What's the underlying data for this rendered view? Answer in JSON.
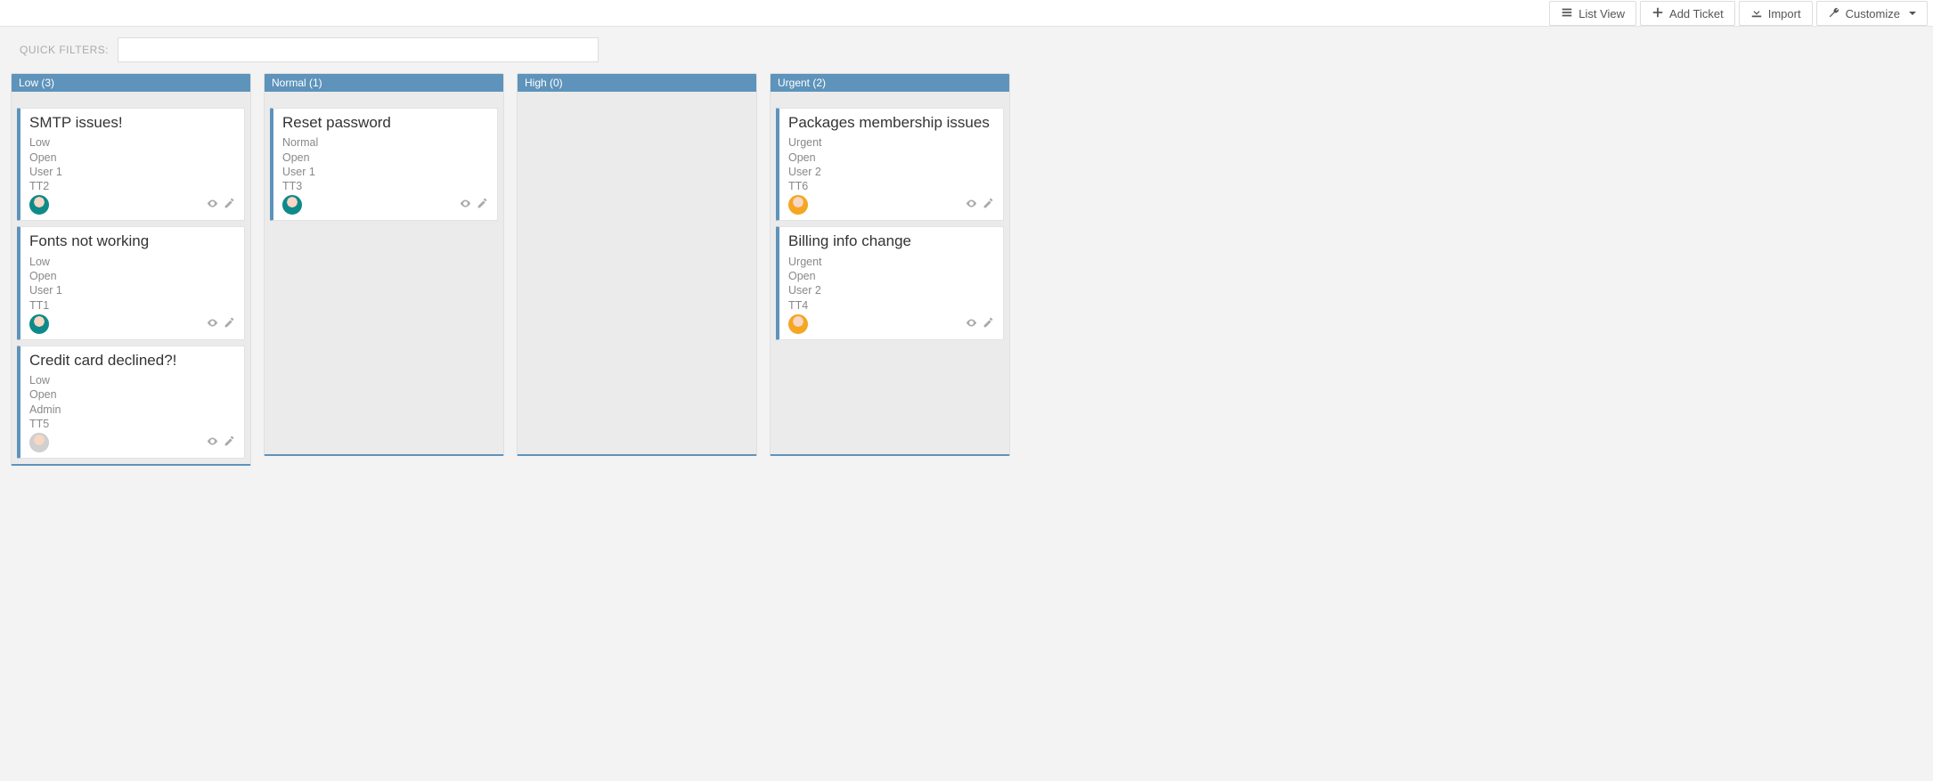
{
  "toolbar": {
    "list_view": "List View",
    "add_ticket": "Add Ticket",
    "import": "Import",
    "customize": "Customize"
  },
  "filters": {
    "label": "QUICK FILTERS:",
    "value": ""
  },
  "columns": [
    {
      "id": "low",
      "header": "Low (3)",
      "cards": [
        {
          "title": "SMTP issues!",
          "priority": "Low",
          "status": "Open",
          "user": "User 1",
          "code": "TT2",
          "avatar": "user1"
        },
        {
          "title": "Fonts not working",
          "priority": "Low",
          "status": "Open",
          "user": "User 1",
          "code": "TT1",
          "avatar": "user1"
        },
        {
          "title": "Credit card declined?!",
          "priority": "Low",
          "status": "Open",
          "user": "Admin",
          "code": "TT5",
          "avatar": "admin"
        }
      ]
    },
    {
      "id": "normal",
      "header": "Normal (1)",
      "cards": [
        {
          "title": "Reset password",
          "priority": "Normal",
          "status": "Open",
          "user": "User 1",
          "code": "TT3",
          "avatar": "user1"
        }
      ]
    },
    {
      "id": "high",
      "header": "High (0)",
      "cards": []
    },
    {
      "id": "urgent",
      "header": "Urgent (2)",
      "cards": [
        {
          "title": "Packages membership issues",
          "priority": "Urgent",
          "status": "Open",
          "user": "User 2",
          "code": "TT6",
          "avatar": "user2"
        },
        {
          "title": "Billing info change",
          "priority": "Urgent",
          "status": "Open",
          "user": "User 2",
          "code": "TT4",
          "avatar": "user2"
        }
      ]
    }
  ]
}
